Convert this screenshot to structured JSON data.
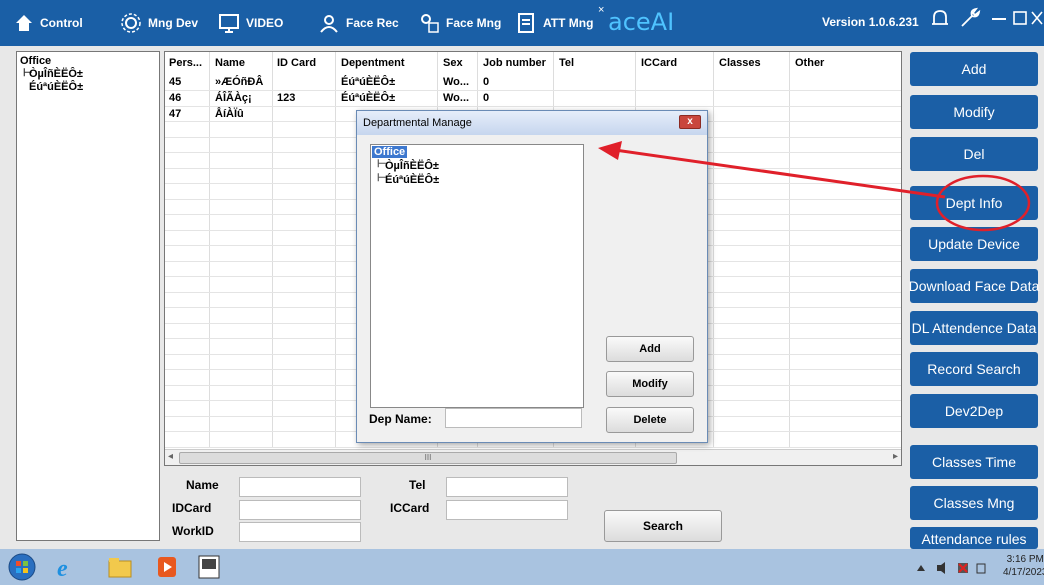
{
  "toolbar": {
    "control": "Control",
    "mng_dev": "Mng Dev",
    "video": "VIDEO",
    "face_rec": "Face Rec",
    "face_mng": "Face Mng",
    "att_mng": "ATT Mng",
    "brand": "aceAI",
    "version": "Version 1.0.6.231"
  },
  "tree": {
    "root": "Office",
    "children": [
      "ÒµÎñÈËÔ±",
      "ÉúªúÈËÔ±"
    ]
  },
  "grid": {
    "columns": [
      "Pers...",
      "Name",
      "ID Card",
      "Depentment",
      "Sex",
      "Job number",
      "Tel",
      "ICCard",
      "Classes",
      "Other"
    ],
    "rows": [
      [
        "45",
        "»ÆÓñÐÂ",
        "",
        "ÉúªúÈËÔ±",
        "Wo...",
        "0"
      ],
      [
        "46",
        "ÁÎÃÀç¡",
        "123",
        "ÉúªúÈËÔ±",
        "Wo...",
        "0"
      ],
      [
        "47",
        "ÅíÀÏû",
        "",
        "",
        "",
        ""
      ]
    ],
    "scroll_mark": "III"
  },
  "search": {
    "name_label": "Name",
    "idcard_label": "IDCard",
    "workid_label": "WorkID",
    "tel_label": "Tel",
    "iccard_label": "ICCard",
    "search_button": "Search"
  },
  "sidebar": {
    "buttons": [
      "Add",
      "Modify",
      "Del",
      "Dept Info",
      "Update Device",
      "Download Face Data",
      "DL Attendence Data",
      "Record Search",
      "Dev2Dep",
      "Classes Time",
      "Classes Mng",
      "Attendance rules"
    ]
  },
  "dialog": {
    "title": "Departmental Manage",
    "close": "x",
    "tree_root": "Office",
    "tree_children": [
      "ÒµÎñÈËÔ±",
      "ÉúªúÈËÔ±"
    ],
    "dep_name_label": "Dep Name:",
    "add": "Add",
    "modify": "Modify",
    "delete": "Delete"
  },
  "taskbar": {
    "time": "3:16 PM",
    "date": "4/17/2023"
  },
  "colors": {
    "topbar": "#1a5fa6",
    "sidebar_button": "#1b5fa6",
    "annotation": "#e0202a"
  }
}
